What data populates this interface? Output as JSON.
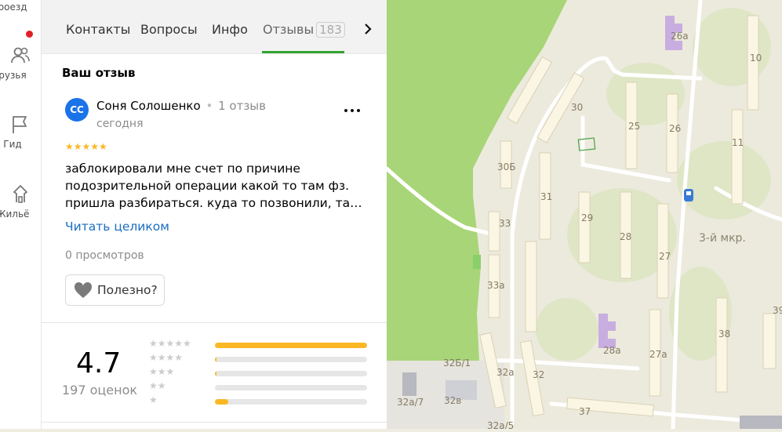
{
  "rail": {
    "items": [
      {
        "label": "роезд",
        "icon": "route-icon"
      },
      {
        "label": "рузья",
        "icon": "friends-icon"
      },
      {
        "label": "Гид",
        "icon": "guide-flag-icon"
      },
      {
        "label": "Жильё",
        "icon": "housing-icon"
      }
    ]
  },
  "tabs": {
    "items": [
      "Контакты",
      "Вопросы",
      "Инфо",
      "Отзывы"
    ],
    "reviews_count": "183"
  },
  "review": {
    "section_title": "Ваш отзыв",
    "avatar_initials": "СС",
    "author": "Соня Солошенко",
    "author_reviews": "1 отзыв",
    "date": "сегодня",
    "rating_stars": 5,
    "text_lines": [
      "заблокировали мне счет по причине",
      "подозрительной операции какой то там фз.",
      "пришла разбираться. куда то позвонили, та…"
    ],
    "read_more": "Читать целиком",
    "views": "0 просмотров",
    "useful_label": "Полезно?"
  },
  "summary": {
    "rating": "4.7",
    "count_label": "197 оценок",
    "distribution": [
      {
        "stars": 5,
        "fraction": 1.0
      },
      {
        "stars": 4,
        "fraction": 0.01
      },
      {
        "stars": 3,
        "fraction": 0.01
      },
      {
        "stars": 2,
        "fraction": 0.0
      },
      {
        "stars": 1,
        "fraction": 0.09
      }
    ]
  },
  "map": {
    "labels": [
      "26а",
      "10",
      "30",
      "25",
      "26",
      "11",
      "30Б",
      "31",
      "29",
      "28",
      "27",
      "33",
      "33а",
      "3-й мкр.",
      "28а",
      "27а",
      "38",
      "39",
      "32Б/1",
      "32а",
      "32",
      "32а/7",
      "32в",
      "37",
      "32а/5"
    ]
  },
  "colors": {
    "accent_green": "#35a334",
    "star": "#fbb824",
    "link": "#1a6ec2",
    "avatar": "#1a73e8",
    "park": "#a8d578"
  }
}
